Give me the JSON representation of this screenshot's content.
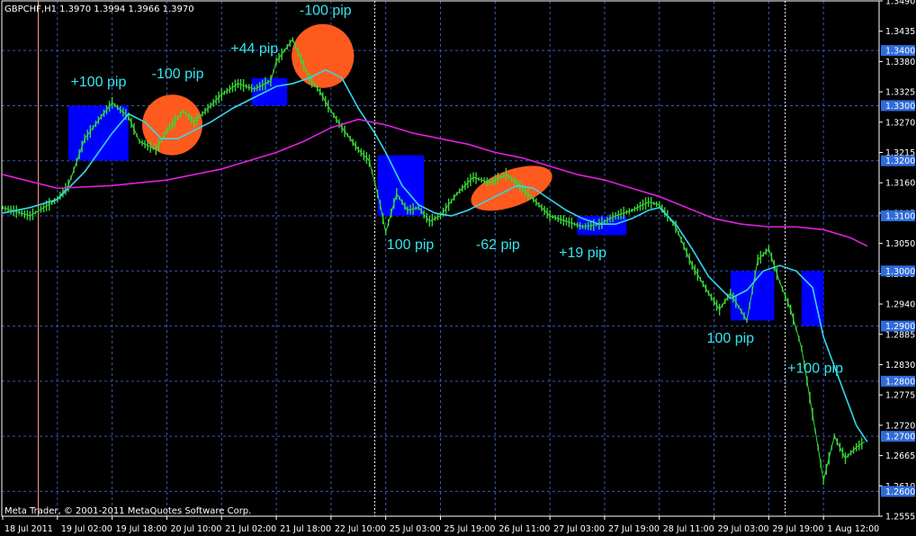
{
  "window": {
    "symbol_header": "GBPCHF,H1  1.3970 1.3994 1.3966 1.3970",
    "footer": "Meta Trader, © 2001-2011 MetaQuotes Software Corp."
  },
  "colors": {
    "background": "#000000",
    "candles": "#39d839",
    "fast_ma": "#35d7ee",
    "slow_ma": "#e020e0",
    "box_blue": "#0000ff",
    "ellipse": "#ff5a1e",
    "annotation_text": "#33e6f0",
    "grid": "#3a58b0",
    "highlight_level": "#2f6cdb"
  },
  "chart_data": {
    "type": "line",
    "title": "GBPCHF,H1",
    "ylim": [
      1.2555,
      1.349
    ],
    "grid": true,
    "price_ticks": [
      "1.3490",
      "1.3435",
      "1.3380",
      "1.3325",
      "1.3270",
      "1.3215",
      "1.3160",
      "1.3105",
      "1.3050",
      "1.2995",
      "1.2940",
      "1.2885",
      "1.2830",
      "1.2775",
      "1.2720",
      "1.2665",
      "1.2610",
      "1.2555"
    ],
    "highlight_levels": [
      "1.3400",
      "1.3300",
      "1.3200",
      "1.3100",
      "1.3000",
      "1.2900",
      "1.2800",
      "1.2700",
      "1.2600"
    ],
    "x_labels": [
      "18 Jul 2011",
      "19 Jul 02:00",
      "19 Jul 18:00",
      "20 Jul 10:00",
      "21 Jul 02:00",
      "21 Jul 18:00",
      "22 Jul 10:00",
      "25 Jul 03:00",
      "25 Jul 19:00",
      "26 Jul 11:00",
      "27 Jul 03:00",
      "27 Jul 19:00",
      "28 Jul 11:00",
      "29 Jul 03:00",
      "29 Jul 19:00",
      "1 Aug 12:00"
    ],
    "x_count": 16,
    "series": [
      {
        "name": "",
        "style": "close",
        "x": [
          0,
          0.5,
          1,
          1.2,
          1.5,
          1.8,
          2,
          2.3,
          2.5,
          2.8,
          3,
          3.3,
          3.5,
          3.8,
          4,
          4.3,
          4.6,
          4.9,
          5,
          5.3,
          5.6,
          5.8,
          6,
          6.2,
          6.5,
          6.7,
          6.9,
          7,
          7.2,
          7.4,
          7.6,
          7.8,
          8,
          8.3,
          8.6,
          8.9,
          9.2,
          9.5,
          9.8,
          10,
          10.3,
          10.6,
          10.9,
          11.2,
          11.5,
          11.8,
          12,
          12.3,
          12.6,
          12.9,
          13.1,
          13.3,
          13.6,
          13.8,
          14,
          14.2,
          14.4,
          14.6,
          14.8,
          15,
          15.2,
          15.4,
          15.6,
          15.75
        ],
        "y": [
          1.3115,
          1.31,
          1.313,
          1.3155,
          1.324,
          1.328,
          1.3305,
          1.328,
          1.3235,
          1.322,
          1.3255,
          1.329,
          1.327,
          1.33,
          1.332,
          1.334,
          1.333,
          1.3345,
          1.338,
          1.342,
          1.335,
          1.3325,
          1.329,
          1.326,
          1.322,
          1.32,
          1.312,
          1.307,
          1.314,
          1.311,
          1.3115,
          1.309,
          1.31,
          1.314,
          1.317,
          1.316,
          1.3175,
          1.315,
          1.312,
          1.31,
          1.309,
          1.308,
          1.3085,
          1.31,
          1.311,
          1.3125,
          1.312,
          1.308,
          1.301,
          1.296,
          1.293,
          1.296,
          1.291,
          1.302,
          1.304,
          1.298,
          1.293,
          1.286,
          1.274,
          1.262,
          1.27,
          1.266,
          1.268,
          1.269
        ]
      },
      {
        "name": "",
        "style": "fast_ma",
        "x": [
          0,
          0.5,
          1,
          1.5,
          2,
          2.3,
          2.6,
          2.9,
          3.2,
          3.5,
          3.8,
          4.2,
          4.6,
          5,
          5.3,
          5.6,
          5.9,
          6.2,
          6.5,
          6.8,
          7,
          7.3,
          7.6,
          7.9,
          8.2,
          8.5,
          8.8,
          9.1,
          9.4,
          9.7,
          10,
          10.3,
          10.6,
          10.9,
          11.2,
          11.5,
          11.8,
          12,
          12.3,
          12.6,
          12.9,
          13.1,
          13.3,
          13.6,
          13.9,
          14.2,
          14.5,
          14.8,
          15,
          15.3,
          15.6,
          15.8
        ],
        "y": [
          1.3105,
          1.3115,
          1.313,
          1.318,
          1.325,
          1.3285,
          1.327,
          1.324,
          1.324,
          1.3255,
          1.327,
          1.3295,
          1.3315,
          1.3335,
          1.334,
          1.335,
          1.3365,
          1.335,
          1.3295,
          1.325,
          1.3215,
          1.3155,
          1.312,
          1.3105,
          1.31,
          1.311,
          1.3125,
          1.314,
          1.3155,
          1.315,
          1.313,
          1.311,
          1.3095,
          1.3085,
          1.3085,
          1.3095,
          1.311,
          1.3115,
          1.3085,
          1.304,
          1.299,
          1.297,
          1.295,
          1.2965,
          1.3,
          1.301,
          1.3,
          1.297,
          1.288,
          1.28,
          1.272,
          1.269
        ]
      },
      {
        "name": "",
        "style": "slow_ma",
        "x": [
          0,
          1,
          2,
          3,
          4,
          5,
          5.5,
          6,
          6.5,
          7,
          7.5,
          8,
          8.5,
          9,
          9.5,
          10,
          10.5,
          11,
          11.5,
          12,
          12.5,
          13,
          13.5,
          14,
          14.5,
          15,
          15.5,
          15.8
        ],
        "y": [
          1.3175,
          1.315,
          1.3155,
          1.3165,
          1.3185,
          1.3215,
          1.3235,
          1.326,
          1.3275,
          1.3265,
          1.325,
          1.324,
          1.323,
          1.3215,
          1.3205,
          1.319,
          1.3175,
          1.3165,
          1.315,
          1.3135,
          1.3115,
          1.3095,
          1.3085,
          1.308,
          1.308,
          1.3075,
          1.306,
          1.3045
        ]
      }
    ],
    "boxes": [
      {
        "x0": 1.2,
        "x1": 2.3,
        "y0": 1.32,
        "y1": 1.33
      },
      {
        "x0": 4.55,
        "x1": 5.2,
        "y0": 1.33,
        "y1": 1.335
      },
      {
        "x0": 6.85,
        "x1": 7.7,
        "y0": 1.31,
        "y1": 1.321
      },
      {
        "x0": 10.5,
        "x1": 11.4,
        "y0": 1.3065,
        "y1": 1.31
      },
      {
        "x0": 13.3,
        "x1": 14.1,
        "y0": 1.291,
        "y1": 1.3
      },
      {
        "x0": 14.6,
        "x1": 15.0,
        "y0": 1.29,
        "y1": 1.3
      }
    ],
    "ellipses": [
      {
        "cx": 3.1,
        "cy": 1.3265,
        "rx": 0.55,
        "ry": 0.0055,
        "rot": 15
      },
      {
        "cx": 5.85,
        "cy": 1.339,
        "rx": 0.57,
        "ry": 0.0058,
        "rot": 0
      },
      {
        "cx": 9.3,
        "cy": 1.315,
        "rx": 0.78,
        "ry": 0.0033,
        "rot": -20
      }
    ],
    "vlines": [
      {
        "x": 0.65,
        "color": "#ff9f8a"
      },
      {
        "x": 6.8,
        "color": "#ffffff"
      },
      {
        "x": 14.3,
        "color": "#ffffff"
      }
    ],
    "annotations": [
      {
        "text": "+100 pip",
        "x": 1.75,
        "y": 1.3335
      },
      {
        "text": "-100 pip",
        "x": 3.2,
        "y": 1.335
      },
      {
        "text": "+44 pip",
        "x": 4.6,
        "y": 1.3395
      },
      {
        "text": "-100 pip",
        "x": 5.9,
        "y": 1.3465
      },
      {
        "text": "100 pip",
        "x": 7.45,
        "y": 1.304
      },
      {
        "text": "-62 pip",
        "x": 9.05,
        "y": 1.304
      },
      {
        "text": "+19 pip",
        "x": 10.6,
        "y": 1.3025
      },
      {
        "text": "100 pip",
        "x": 13.3,
        "y": 1.287
      },
      {
        "text": "+100 pip",
        "x": 14.85,
        "y": 1.2815
      }
    ]
  }
}
